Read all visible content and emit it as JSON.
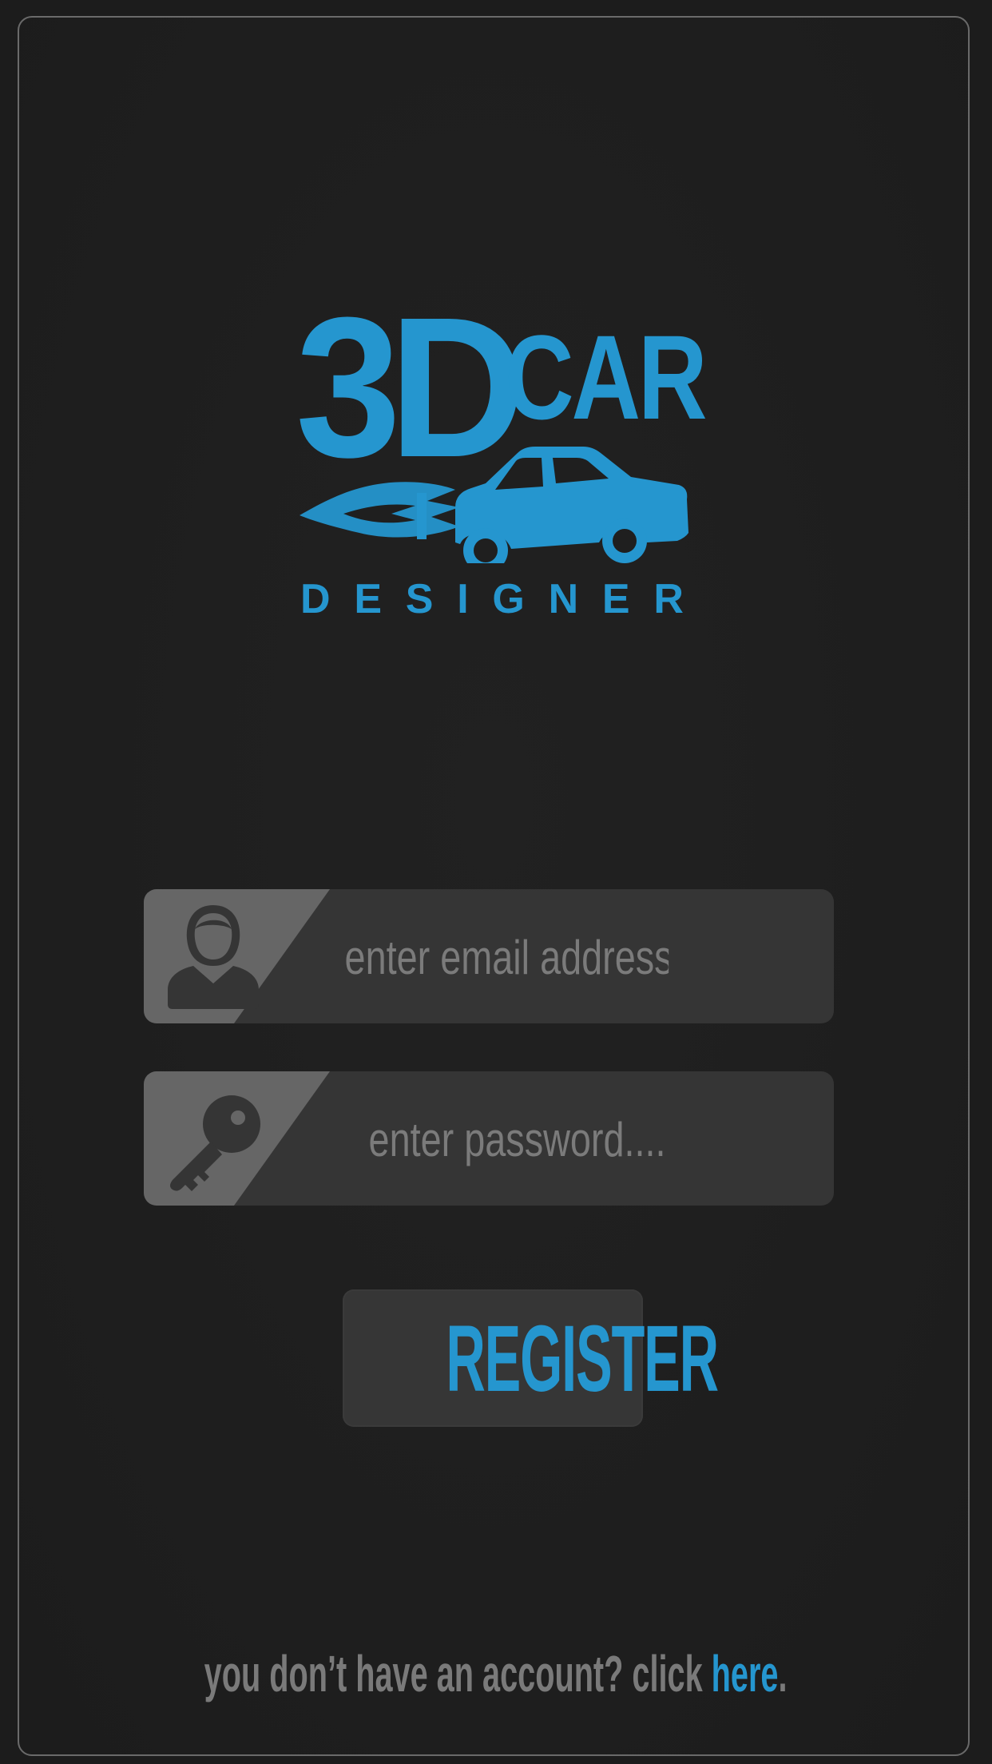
{
  "app": {
    "logo": {
      "line1_big": "3D",
      "line1_small": "CAR",
      "line2_letters": [
        "D",
        "E",
        "S",
        "I",
        "G",
        "N",
        "E",
        "R"
      ]
    },
    "email_field": {
      "placeholder": "enter email address...",
      "icon": "user-icon"
    },
    "password_field": {
      "placeholder": "enter password....",
      "icon": "key-icon"
    },
    "register_button": {
      "label": "REGISTER"
    },
    "footer": {
      "prefix": "you don’t have an account? click ",
      "link": "here",
      "suffix": "."
    },
    "colors": {
      "accent": "#2596cf",
      "background": "#1c1c1c",
      "field_bg": "#353535",
      "icon_panel": "#666666",
      "text_muted": "#7b7b7b"
    }
  }
}
